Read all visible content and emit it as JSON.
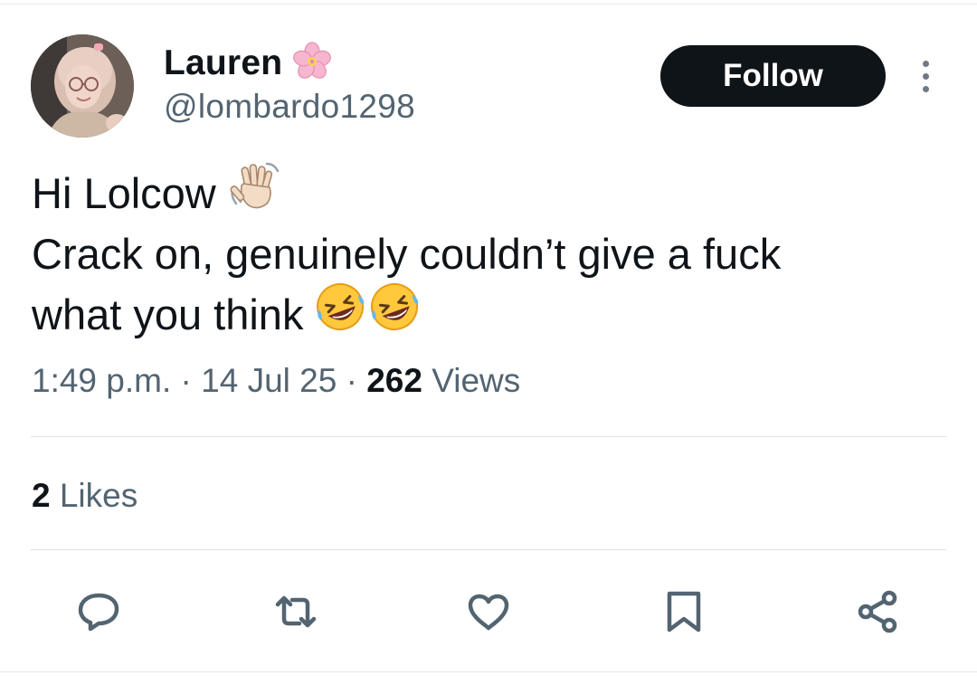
{
  "user": {
    "display_name": "Lauren",
    "name_emoji": "cherry-blossom",
    "handle": "@lombardo1298",
    "avatar": "profile-photo"
  },
  "header": {
    "follow_label": "Follow",
    "more_icon": "more-vertical-icon"
  },
  "tweet": {
    "line1": "Hi Lolcow",
    "line1_emoji": "waving-hand",
    "line2": "Crack on, genuinely couldn’t give a fuck",
    "line3": "what you think",
    "line3_emoji": "rolling-on-floor-laughing"
  },
  "meta": {
    "time": "1:49 p.m.",
    "separator": "·",
    "date": "14 Jul 25",
    "views_count": "262",
    "views_label": "Views"
  },
  "stats": {
    "likes_count": "2",
    "likes_label": "Likes"
  },
  "actions": {
    "reply_icon": "reply-icon",
    "repost_icon": "repost-icon",
    "like_icon": "like-icon",
    "bookmark_icon": "bookmark-icon",
    "share_icon": "share-icon"
  },
  "colors": {
    "text_primary": "#0f1419",
    "text_secondary": "#536471",
    "follow_bg": "#0f1419",
    "divider": "#dfe3e6"
  }
}
